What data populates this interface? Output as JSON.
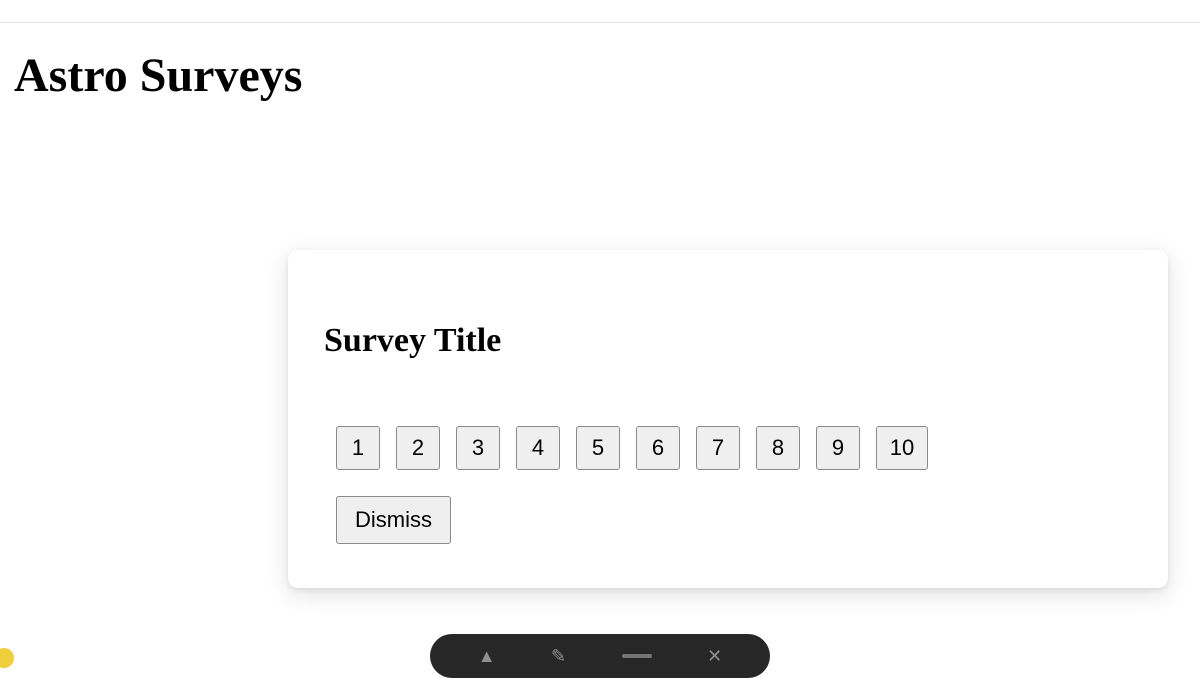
{
  "page": {
    "title": "Astro Surveys"
  },
  "survey": {
    "title": "Survey Title",
    "ratings": [
      "1",
      "2",
      "3",
      "4",
      "5",
      "6",
      "7",
      "8",
      "9",
      "10"
    ],
    "dismiss_label": "Dismiss"
  }
}
